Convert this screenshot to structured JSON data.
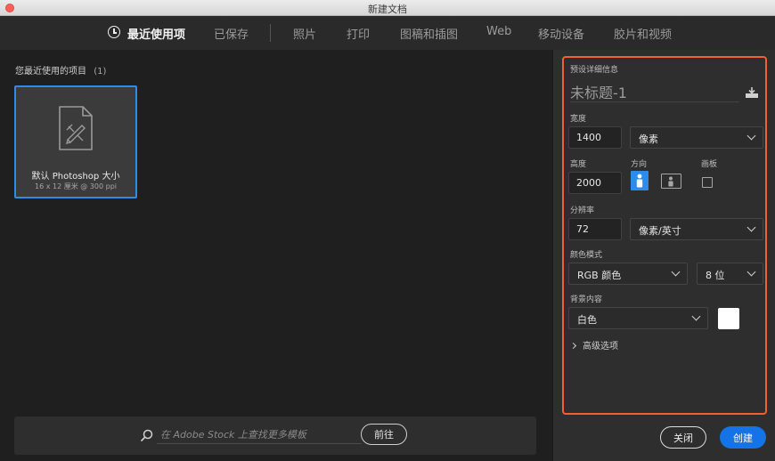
{
  "window": {
    "title": "新建文档"
  },
  "tabs": [
    {
      "label": "最近使用项",
      "active": true
    },
    {
      "label": "已保存"
    },
    {
      "label": "照片"
    },
    {
      "label": "打印"
    },
    {
      "label": "图稿和插图"
    },
    {
      "label": "Web"
    },
    {
      "label": "移动设备"
    },
    {
      "label": "胶片和视频"
    }
  ],
  "recent": {
    "heading": "您最近使用的项目",
    "count": "(1)",
    "items": [
      {
        "title": "默认 Photoshop 大小",
        "subtitle": "16 x 12 厘米 @ 300 ppi",
        "icon": "document-pencil-icon"
      }
    ]
  },
  "stock_search": {
    "placeholder": "在 Adobe Stock 上查找更多模板",
    "button_label": "前往",
    "icon": "search-icon"
  },
  "details": {
    "section_label": "预设详细信息",
    "doc_name": "未标题-1",
    "width": {
      "label": "宽度",
      "value": "1400",
      "unit": "像素"
    },
    "height": {
      "label": "高度",
      "value": "2000"
    },
    "orientation": {
      "label": "方向",
      "selected": "portrait"
    },
    "artboard": {
      "label": "画板",
      "checked": false
    },
    "resolution": {
      "label": "分辨率",
      "value": "72",
      "unit": "像素/英寸"
    },
    "color_mode": {
      "label": "颜色模式",
      "value": "RGB 颜色",
      "depth": "8 位"
    },
    "background": {
      "label": "背景内容",
      "value": "白色",
      "swatch": "#ffffff"
    },
    "advanced_label": "高级选项"
  },
  "footer": {
    "close_label": "关闭",
    "create_label": "创建"
  },
  "colors": {
    "accent": "#1473e6",
    "highlight": "#f0612f",
    "selection": "#2d8ceb"
  }
}
